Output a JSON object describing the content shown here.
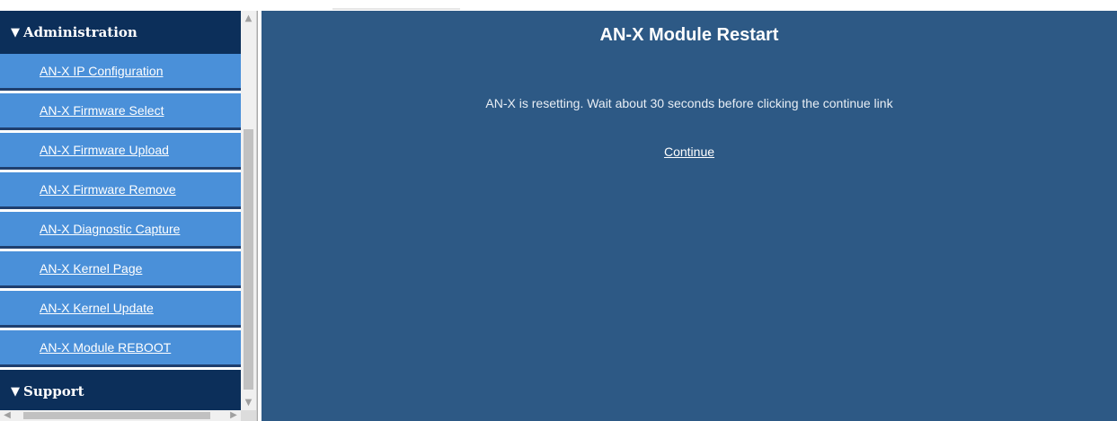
{
  "sidebar": {
    "sections": [
      {
        "label": "Administration",
        "expanded": true
      },
      {
        "label": "Support",
        "expanded": true
      }
    ],
    "items": [
      {
        "label": "AN-X IP Configuration"
      },
      {
        "label": "AN-X Firmware Select"
      },
      {
        "label": "AN-X Firmware Upload"
      },
      {
        "label": "AN-X Firmware Remove"
      },
      {
        "label": "AN-X Diagnostic Capture"
      },
      {
        "label": "AN-X Kernel Page"
      },
      {
        "label": "AN-X Kernel Update"
      },
      {
        "label": "AN-X Module REBOOT"
      }
    ],
    "icons": {
      "expand": "triangle-down-icon"
    }
  },
  "main": {
    "title": "AN-X Module Restart",
    "message": "AN-X is resetting. Wait about 30 seconds before clicking the continue link",
    "continue_label": "Continue"
  },
  "colors": {
    "section_header_bg": "#0c2f5a",
    "nav_item_bg": "#4a90d9",
    "nav_item_border": "#1f3f6e",
    "main_bg": "#2d5985",
    "text": "#ffffff"
  }
}
